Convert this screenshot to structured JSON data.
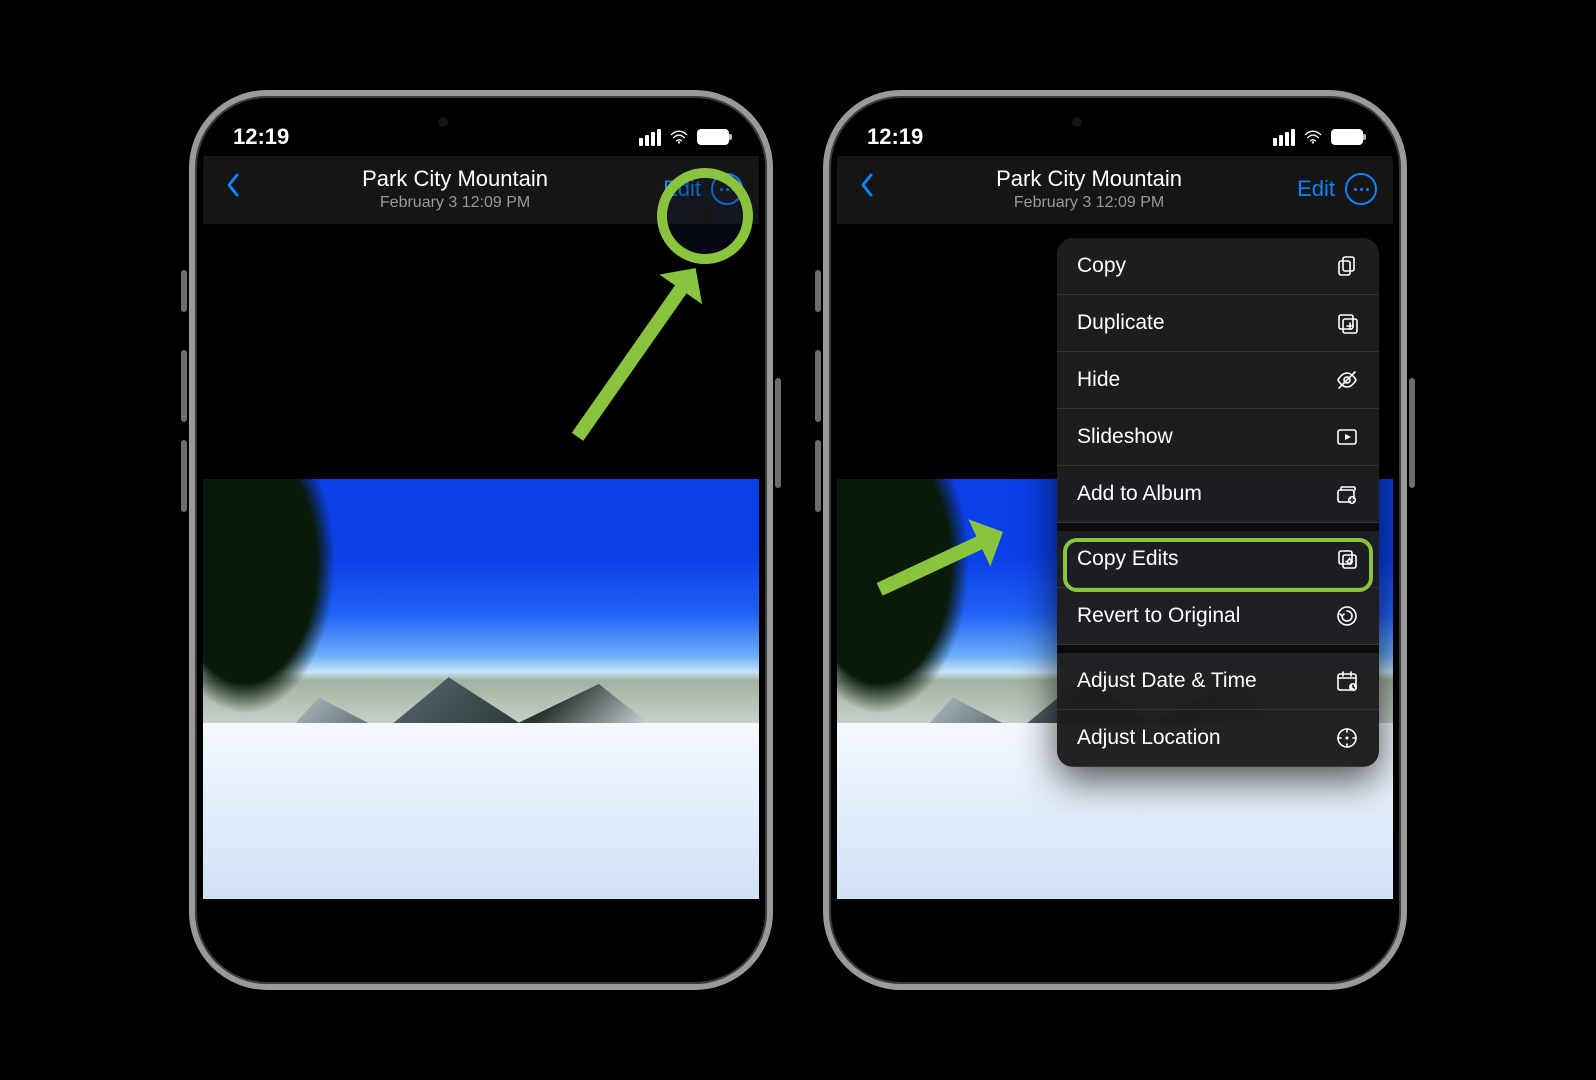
{
  "status": {
    "time": "12:19"
  },
  "header": {
    "title": "Park City Mountain",
    "subtitle": "February 3  12:09 PM",
    "edit_label": "Edit"
  },
  "menu": {
    "items": [
      {
        "label": "Copy",
        "icon": "copy"
      },
      {
        "label": "Duplicate",
        "icon": "duplicate"
      },
      {
        "label": "Hide",
        "icon": "hide"
      },
      {
        "label": "Slideshow",
        "icon": "slideshow"
      },
      {
        "label": "Add to Album",
        "icon": "album"
      },
      {
        "label": "Copy Edits",
        "icon": "copyedits"
      },
      {
        "label": "Revert to Original",
        "icon": "revert"
      },
      {
        "label": "Adjust Date & Time",
        "icon": "datetime"
      },
      {
        "label": "Adjust Location",
        "icon": "location"
      }
    ],
    "group_breaks_after": [
      4,
      6
    ],
    "highlighted_index": 5
  }
}
